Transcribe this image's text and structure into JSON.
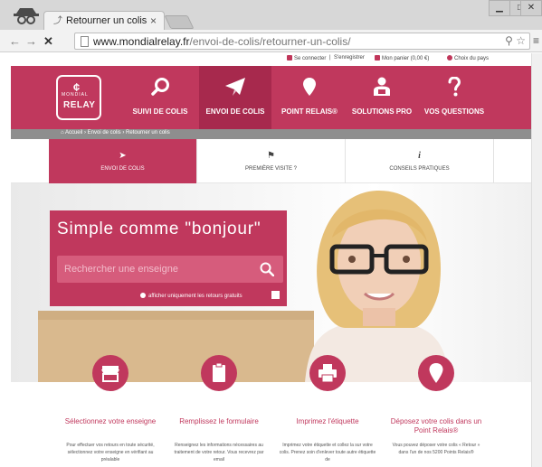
{
  "browser": {
    "tab_title": "Retourner un colis",
    "tab_close": "×",
    "url_domain": "www.mondialrelay.fr",
    "url_path": "/envoi-de-colis/retourner-un-colis/",
    "min_label": "▁",
    "max_label": "□",
    "close_label": "✕"
  },
  "utility": {
    "login": "Se connecter",
    "separator": "|",
    "register": "S'enregistrer",
    "cart": "Mon panier (0,00 €)",
    "country": "Choix du pays"
  },
  "logo": {
    "brand": "RELAY",
    "brand_top": "MONDIAL"
  },
  "nav": [
    {
      "label": "SUIVI DE COLIS",
      "icon": "search-icon"
    },
    {
      "label": "ENVOI DE COLIS",
      "icon": "paper-plane-icon"
    },
    {
      "label": "POINT RELAIS®",
      "icon": "map-pin-icon"
    },
    {
      "label": "SOLUTIONS PRO",
      "icon": "business-person-icon"
    },
    {
      "label": "VOS QUESTIONS",
      "icon": "question-mark-icon"
    }
  ],
  "breadcrumb": {
    "home": "Accueil",
    "level1": "Envoi de colis",
    "level2": "Retourner un colis",
    "sep": "›"
  },
  "subtabs": [
    {
      "label": "ENVOI DE COLIS",
      "icon": "paper-plane-icon"
    },
    {
      "label": "PREMIÈRE VISITE ?",
      "icon": "flag-icon"
    },
    {
      "label": "CONSEILS PRATIQUES",
      "icon": "info-icon"
    }
  ],
  "hero": {
    "title": "Simple comme \"bonjour\"",
    "search_placeholder": "Rechercher une enseigne",
    "returns_label": "afficher uniquement les retours gratuits"
  },
  "steps": [
    {
      "icon": "store-icon",
      "title": "Sélectionnez votre enseigne",
      "text": "Pour effectuer vos retours en toute sécurité, sélectionnez votre enseigne en vérifiant au préalable"
    },
    {
      "icon": "clipboard-icon",
      "title": "Remplissez le formulaire",
      "text": "Renseignez les informations nécessaires au traitement de votre retour. Vous recevrez par email"
    },
    {
      "icon": "printer-icon",
      "title": "Imprimez l'étiquette",
      "text": "Imprimez votre étiquette et collez la sur votre colis. Prenez soin d'enlever toute autre étiquette de"
    },
    {
      "icon": "map-pin-icon",
      "title": "Déposez votre colis dans un Point Relais®",
      "text": "Vous pouvez déposer votre colis « Retour » dans l'un de nos 5200 Points Relais®"
    }
  ],
  "colors": {
    "brand": "#c0385d",
    "brand_dark": "#a7294d",
    "breadcrumb_bg": "#8e8e8e"
  }
}
